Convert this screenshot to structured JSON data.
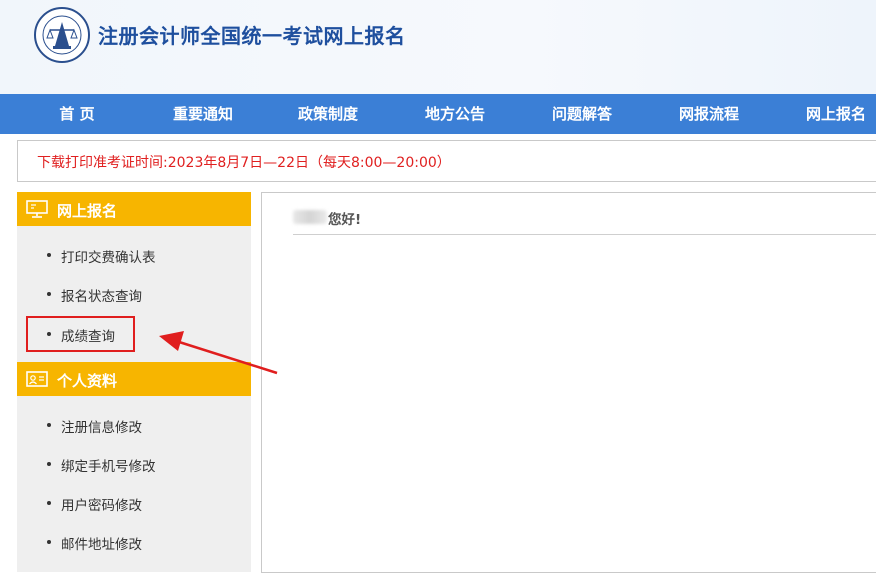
{
  "header": {
    "title": "注册会计师全国统一考试网上报名",
    "logo_icon": "cicpa-seal-logo"
  },
  "nav": {
    "items": [
      "首 页",
      "重要通知",
      "政策制度",
      "地方公告",
      "问题解答",
      "网报流程",
      "网上报名"
    ]
  },
  "notice": {
    "text": "下载打印准考证时间:2023年8月7日—22日（每天8:00—20:00）"
  },
  "sidebar": {
    "sections": [
      {
        "title": "网上报名",
        "icon": "monitor-icon",
        "items": [
          "打印交费确认表",
          "报名状态查询",
          "成绩查询"
        ]
      },
      {
        "title": "个人资料",
        "icon": "id-card-icon",
        "items": [
          "注册信息修改",
          "绑定手机号修改",
          "用户密码修改",
          "邮件地址修改"
        ]
      }
    ]
  },
  "main": {
    "greeting": "您好!"
  },
  "colors": {
    "nav_bg": "#3b7fd6",
    "section_header": "#f7b500",
    "notice_text": "#e02020",
    "highlight": "#e01e1e",
    "title": "#1e4f9e"
  }
}
